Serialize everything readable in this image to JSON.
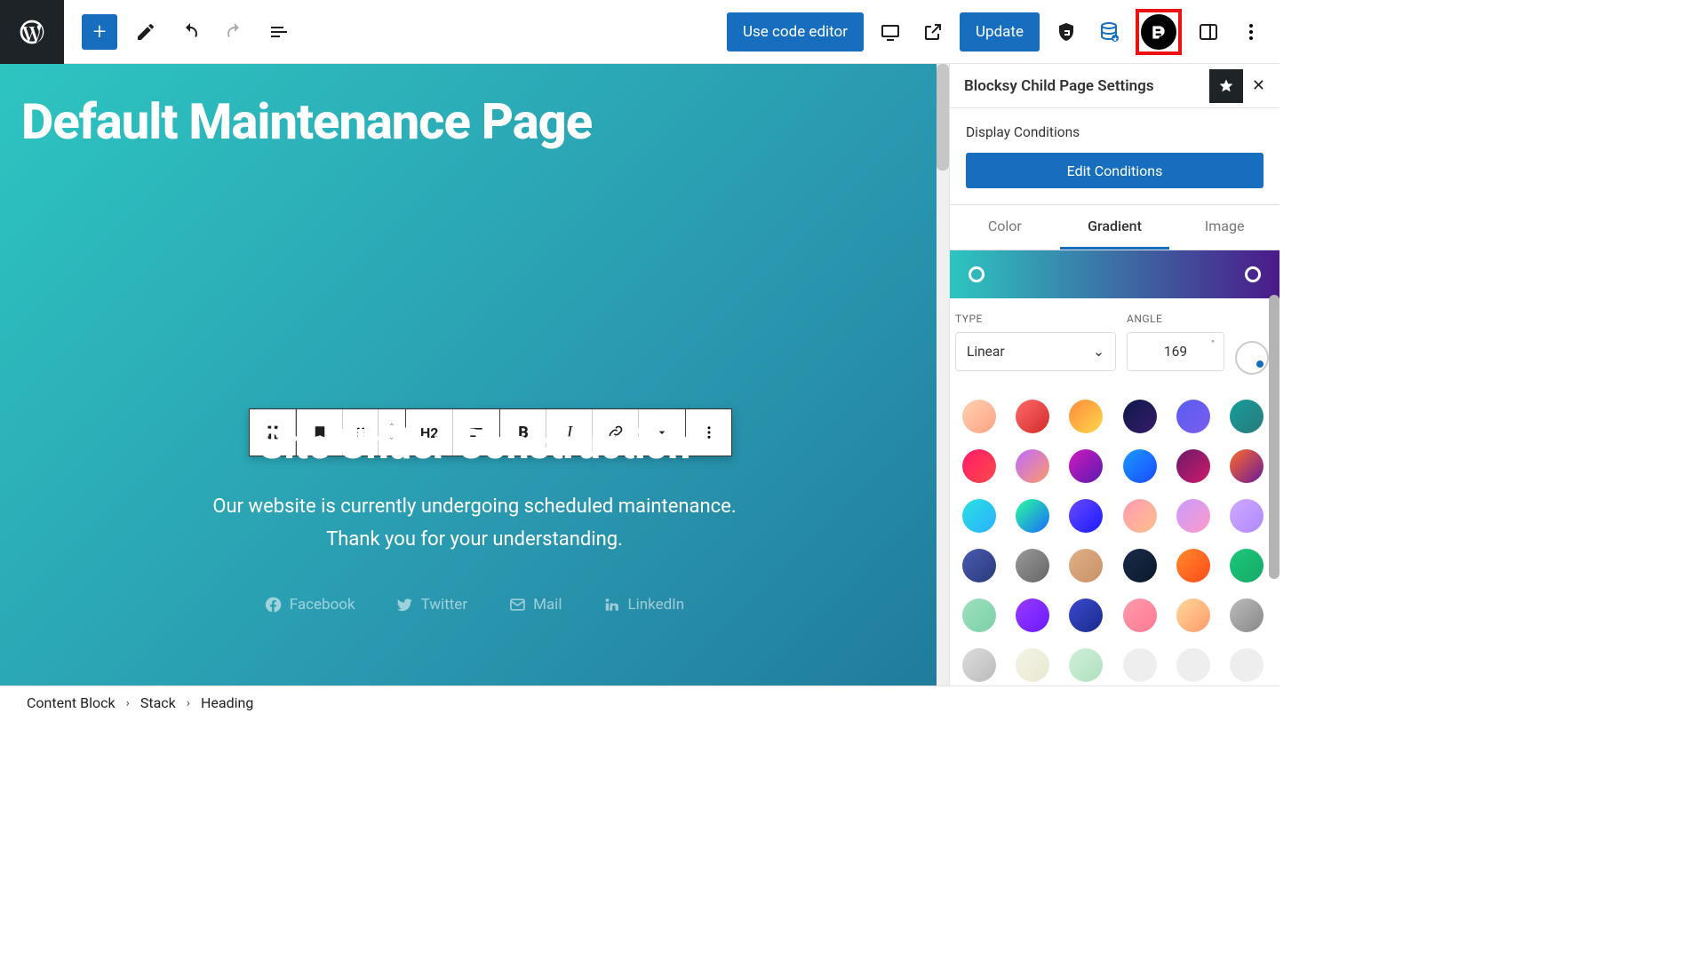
{
  "topbar": {
    "code_editor": "Use code editor",
    "update": "Update"
  },
  "canvas": {
    "page_title": "Default Maintenance Page",
    "heading": "Site Under Construction",
    "paragraph_l1": "Our website is currently undergoing scheduled maintenance.",
    "paragraph_l2": "Thank you for your understanding.",
    "socials": {
      "fb": "Facebook",
      "tw": "Twitter",
      "mail": "Mail",
      "li": "LinkedIn"
    }
  },
  "toolbar": {
    "h2": "H2"
  },
  "sidebar": {
    "title": "Blocksy Child Page Settings",
    "conditions_label": "Display Conditions",
    "edit_conditions": "Edit Conditions",
    "tabs": {
      "color": "Color",
      "gradient": "Gradient",
      "image": "Image"
    },
    "type_label": "TYPE",
    "angle_label": "ANGLE",
    "type_value": "Linear",
    "angle_value": "169",
    "presets": [
      "linear-gradient(135deg,#ffd1b3,#ffa382)",
      "linear-gradient(135deg,#ff6a6a,#d12a2a)",
      "linear-gradient(135deg,#ff8a3d,#ffd84a)",
      "linear-gradient(135deg,#0b1a4a,#3a1a6a)",
      "linear-gradient(135deg,#5a5df0,#7a5df0)",
      "linear-gradient(135deg,#169c9c,#2a7a7a)",
      "linear-gradient(135deg,#ff1a6a,#ff4a4a)",
      "linear-gradient(135deg,#bb6aff,#ff9a6a)",
      "linear-gradient(135deg,#d11abf,#5a1ab0)",
      "linear-gradient(135deg,#1a9aff,#1a4aff)",
      "linear-gradient(135deg,#6a1a6a,#d11a6a)",
      "linear-gradient(135deg,#ff6a2a,#6a1a9a)",
      "linear-gradient(135deg,#2ae0e0,#2ab0ff)",
      "linear-gradient(135deg,#2aff9a,#1a6aff)",
      "linear-gradient(135deg,#6a4aff,#1a1aff)",
      "linear-gradient(135deg,#ff9ab3,#ffc08a)",
      "linear-gradient(135deg,#c89aff,#ff9ac8)",
      "linear-gradient(135deg,#d0aaff,#b088ff)",
      "linear-gradient(135deg,#4a5ab0,#2a3a7a)",
      "linear-gradient(135deg,#999,#666)",
      "linear-gradient(135deg,#e0b088,#c89066)",
      "linear-gradient(135deg,#1a2a4a,#0a1a2a)",
      "linear-gradient(135deg,#ff8a2a,#ff4a1a)",
      "linear-gradient(135deg,#1ac87a,#18a868)",
      "linear-gradient(135deg,#a0e0c0,#7ad0a8)",
      "linear-gradient(135deg,#9a3aff,#6a1aff)",
      "linear-gradient(135deg,#3a4ad0,#1a2a8a)",
      "linear-gradient(135deg,#ff9ab0,#ff7a90)",
      "linear-gradient(135deg,#ffd89a,#ff9a6a)",
      "linear-gradient(135deg,#bbb,#888)",
      "linear-gradient(135deg,#ddd,#bbb)",
      "linear-gradient(135deg,#f4f4e6,#e8e8d0)",
      "linear-gradient(135deg,#d0f0d8,#b0e0c0)",
      "linear-gradient(135deg,#eee,#eee)",
      "linear-gradient(135deg,#eee,#eee)",
      "linear-gradient(135deg,#eee,#eee)"
    ]
  },
  "breadcrumb": {
    "a": "Content Block",
    "b": "Stack",
    "c": "Heading"
  }
}
